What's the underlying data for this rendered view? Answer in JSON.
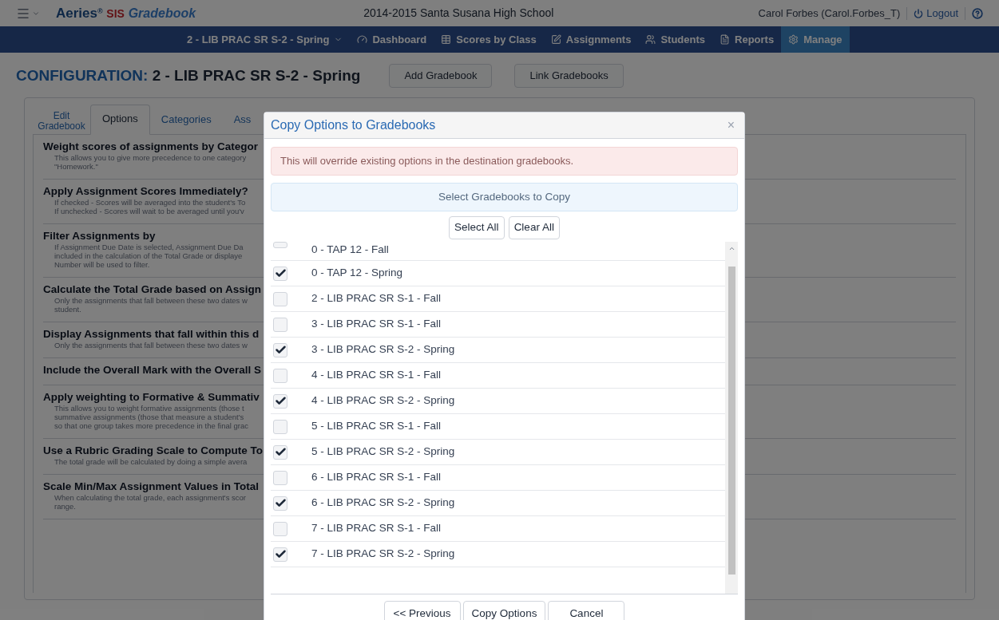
{
  "header": {
    "brand": "Aeries",
    "brand_sup": "®",
    "brand_sis": "SIS",
    "brand_app": "Gradebook",
    "school": "2014-2015 Santa Susana High School",
    "user": "Carol Forbes (Carol.Forbes_T)",
    "logout": "Logout"
  },
  "nav": [
    {
      "label": "2 - LIB PRAC SR S-2 - Spring",
      "selected": false
    },
    {
      "label": "Dashboard",
      "selected": false
    },
    {
      "label": "Scores by Class",
      "selected": false
    },
    {
      "label": "Assignments",
      "selected": false
    },
    {
      "label": "Students",
      "selected": false
    },
    {
      "label": "Reports",
      "selected": false
    },
    {
      "label": "Manage",
      "selected": true
    }
  ],
  "page": {
    "title_prefix": "CONFIGURATION:",
    "title": "2 - LIB PRAC SR S-2 - Spring",
    "buttons": [
      "Add Gradebook",
      "Link Gradebooks"
    ]
  },
  "tabs": [
    {
      "label": "Edit Gradebook",
      "selected": false
    },
    {
      "label": "Options",
      "selected": true
    },
    {
      "label": "Categories",
      "selected": false
    },
    {
      "label": "Ass",
      "selected": false
    }
  ],
  "options": [
    {
      "title": "Weight scores of assignments by Categor",
      "description": [
        "This allows you to give more precedence to one category",
        "\"Homework.\""
      ]
    },
    {
      "title": "Apply Assignment Scores Immediately?",
      "description": [
        "If checked - Scores will be averaged into the student's To",
        "If unchecked - Scores will wait to be averaged until you'v"
      ]
    },
    {
      "title": "Filter Assignments by",
      "description": [
        "If Assignment Due Date is selected, Assignment Due Da",
        "included in the calculation of the Total Grade or displaye",
        "Number will be used to filter."
      ]
    },
    {
      "title": "Calculate the Total Grade based on Assign",
      "description": [
        "Only the assignments that fall between these two dates w",
        "student."
      ]
    },
    {
      "title": "Display Assignments that fall within this d",
      "description": [
        "Only the assignments that fall between these two dates w"
      ]
    },
    {
      "title": "Include the Overall Mark with the Overall S"
    },
    {
      "title": "Apply weighting to Formative & Summativ",
      "description": [
        "This allows you to weight formative assignments (those t",
        "summative assignments (those that measure a student's",
        "so that one group takes more precedence in the final grac"
      ]
    },
    {
      "title": "Use a Rubric Grading Scale to Compute To",
      "description": [
        "The total grade will be calculated by doing a simple avera"
      ]
    },
    {
      "title": "Scale Min/Max Assignment Values in Total",
      "description": [
        "When calculating the total grade, each assignment's scor",
        "range."
      ]
    }
  ],
  "modal": {
    "title": "Copy Options to Gradebooks",
    "close": "×",
    "alert": "This will override existing options in the destination gradebooks.",
    "heading": "Select Gradebooks to Copy",
    "select_all": "Select All",
    "clear_all": "Clear All",
    "items": [
      {
        "label": "0 - TAP 12 - Fall",
        "checked": false
      },
      {
        "label": "0 - TAP 12 - Spring",
        "checked": true
      },
      {
        "label": "2 - LIB PRAC SR S-1 - Fall",
        "checked": false
      },
      {
        "label": "3 - LIB PRAC SR S-1 - Fall",
        "checked": false
      },
      {
        "label": "3 - LIB PRAC SR S-2 - Spring",
        "checked": true
      },
      {
        "label": "4 - LIB PRAC SR S-1 - Fall",
        "checked": false
      },
      {
        "label": "4 - LIB PRAC SR S-2 - Spring",
        "checked": true
      },
      {
        "label": "5 - LIB PRAC SR S-1 - Fall",
        "checked": false
      },
      {
        "label": "5 - LIB PRAC SR S-2 - Spring",
        "checked": true
      },
      {
        "label": "6 - LIB PRAC SR S-1 - Fall",
        "checked": false
      },
      {
        "label": "6 - LIB PRAC SR S-2 - Spring",
        "checked": true
      },
      {
        "label": "7 - LIB PRAC SR S-1 - Fall",
        "checked": false
      },
      {
        "label": "7 - LIB PRAC SR S-2 - Spring",
        "checked": true
      }
    ],
    "footer": [
      "<< Previous",
      "Copy Options",
      "Cancel"
    ]
  }
}
